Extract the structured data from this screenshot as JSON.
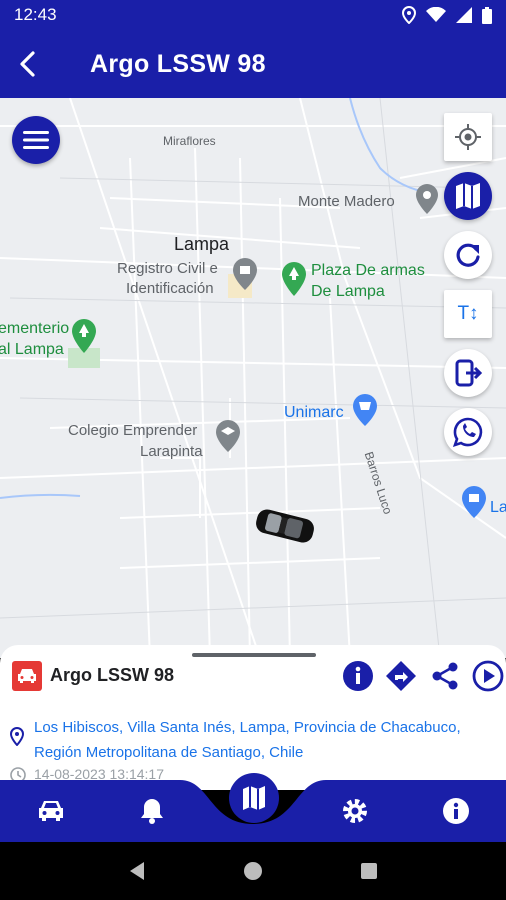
{
  "status_bar": {
    "time": "12:43"
  },
  "header": {
    "title": "Argo LSSW 98"
  },
  "map": {
    "labels": {
      "miraflores": "Miraflores",
      "monte_madero": "Monte Madero",
      "lampa": "Lampa",
      "registro_1": "Registro Civil e",
      "registro_2": "Identificación",
      "plaza_1": "Plaza De armas",
      "plaza_2": "De Lampa",
      "cementerio_1": "ementerio",
      "cementerio_2": "al Lampa",
      "unimarc": "Unimarc",
      "colegio_1": "Colegio Emprender",
      "colegio_2": "Larapinta",
      "barros_luco": "Barros Luco",
      "la": "La"
    }
  },
  "side_buttons": [
    {
      "icon": "my-location-icon"
    },
    {
      "icon": "map-icon"
    },
    {
      "icon": "refresh-icon"
    },
    {
      "icon": "text-size-icon",
      "label": "T↕"
    },
    {
      "icon": "exit-icon"
    },
    {
      "icon": "whatsapp-icon"
    }
  ],
  "vehicle": {
    "name": "Argo LSSW 98",
    "address": "Los Hibiscos, Villa Santa Inés, Lampa, Provincia de Chacabuco, Región Metropolitana de Santiago, Chile",
    "timestamp": "14-08-2023 13:14:17"
  },
  "bottom_nav": [
    "car-icon",
    "bell-icon",
    "map-icon",
    "gear-icon",
    "info-icon"
  ],
  "colors": {
    "primary": "#1a1fa8",
    "accent_red": "#e53935",
    "link": "#1a73e8"
  }
}
